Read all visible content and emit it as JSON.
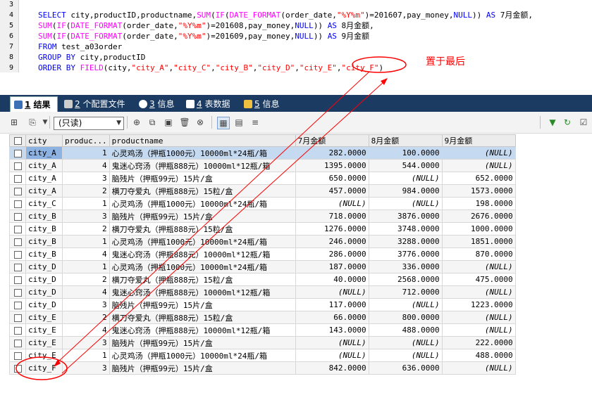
{
  "editor": {
    "lines": [
      {
        "n": "3",
        "parts": []
      },
      {
        "n": "4",
        "parts": [
          {
            "c": "k",
            "t": "SELECT"
          },
          {
            "c": "t",
            "t": " city,productID,productname,"
          },
          {
            "c": "f",
            "t": "SUM"
          },
          {
            "c": "t",
            "t": "("
          },
          {
            "c": "f",
            "t": "IF"
          },
          {
            "c": "t",
            "t": "("
          },
          {
            "c": "f",
            "t": "DATE_FORMAT"
          },
          {
            "c": "t",
            "t": "(order_date,"
          },
          {
            "c": "s",
            "t": "\"%Y%m\""
          },
          {
            "c": "t",
            "t": ")=201607,pay_money,"
          },
          {
            "c": "k",
            "t": "NULL"
          },
          {
            "c": "t",
            "t": ")) "
          },
          {
            "c": "k",
            "t": "AS"
          },
          {
            "c": "t",
            "t": " 7月金额,"
          }
        ]
      },
      {
        "n": "5",
        "parts": [
          {
            "c": "f",
            "t": "SUM"
          },
          {
            "c": "t",
            "t": "("
          },
          {
            "c": "f",
            "t": "IF"
          },
          {
            "c": "t",
            "t": "("
          },
          {
            "c": "f",
            "t": "DATE_FORMAT"
          },
          {
            "c": "t",
            "t": "(order_date,"
          },
          {
            "c": "s",
            "t": "\"%Y%m\""
          },
          {
            "c": "t",
            "t": ")=201608,pay_money,"
          },
          {
            "c": "k",
            "t": "NULL"
          },
          {
            "c": "t",
            "t": ")) "
          },
          {
            "c": "k",
            "t": "AS"
          },
          {
            "c": "t",
            "t": " 8月金额,"
          }
        ]
      },
      {
        "n": "6",
        "parts": [
          {
            "c": "f",
            "t": "SUM"
          },
          {
            "c": "t",
            "t": "("
          },
          {
            "c": "f",
            "t": "IF"
          },
          {
            "c": "t",
            "t": "("
          },
          {
            "c": "f",
            "t": "DATE_FORMAT"
          },
          {
            "c": "t",
            "t": "(order_date,"
          },
          {
            "c": "s",
            "t": "\"%Y%m\""
          },
          {
            "c": "t",
            "t": ")=201609,pay_money,"
          },
          {
            "c": "k",
            "t": "NULL"
          },
          {
            "c": "t",
            "t": ")) "
          },
          {
            "c": "k",
            "t": "AS"
          },
          {
            "c": "t",
            "t": " 9月金额"
          }
        ]
      },
      {
        "n": "7",
        "parts": [
          {
            "c": "k",
            "t": "FROM"
          },
          {
            "c": "t",
            "t": " test_a03order"
          }
        ]
      },
      {
        "n": "8",
        "parts": [
          {
            "c": "k",
            "t": "GROUP BY"
          },
          {
            "c": "t",
            "t": " city,productID"
          }
        ]
      },
      {
        "n": "9",
        "parts": [
          {
            "c": "k",
            "t": "ORDER BY"
          },
          {
            "c": "t",
            "t": " "
          },
          {
            "c": "f",
            "t": "FIELD"
          },
          {
            "c": "t",
            "t": "(city,"
          },
          {
            "c": "s",
            "t": "\"city_A\""
          },
          {
            "c": "t",
            "t": ","
          },
          {
            "c": "s",
            "t": "\"city_C\""
          },
          {
            "c": "t",
            "t": ","
          },
          {
            "c": "s",
            "t": "\"city_B\""
          },
          {
            "c": "t",
            "t": ","
          },
          {
            "c": "s",
            "t": "\"city_D\""
          },
          {
            "c": "t",
            "t": ","
          },
          {
            "c": "s",
            "t": "\"city_E\""
          },
          {
            "c": "t",
            "t": ","
          },
          {
            "c": "s",
            "t": "\"city_F\""
          },
          {
            "c": "t",
            "t": ")"
          }
        ]
      }
    ]
  },
  "annotation": {
    "note": "置于最后",
    "color": "#ff0000"
  },
  "tabs": [
    {
      "num": "1",
      "label": " 结果",
      "icon": "result-grid-icon",
      "active": true
    },
    {
      "num": "2",
      "label": " 个配置文件",
      "icon": "profile-icon",
      "active": false
    },
    {
      "num": "3",
      "label": " 信息",
      "icon": "info-icon",
      "active": false
    },
    {
      "num": "4",
      "label": " 表数据",
      "icon": "table-data-icon",
      "active": false
    },
    {
      "num": "5",
      "label": " 信息",
      "icon": "info-extra-icon",
      "active": false
    }
  ],
  "toolbar": {
    "mode_select": "(只读)"
  },
  "grid": {
    "columns": [
      "city",
      "produc...",
      "productname",
      "7月金额",
      "8月金额",
      "9月金额"
    ],
    "rows": [
      [
        "city_A",
        "1",
        "心灵鸡汤（押瓶1000元）10000ml*24瓶/箱",
        "282.0000",
        "100.0000",
        "(NULL)"
      ],
      [
        "city_A",
        "4",
        "鬼迷心窍汤（押瓶888元）10000ml*12瓶/箱",
        "1395.0000",
        "544.0000",
        "(NULL)"
      ],
      [
        "city_A",
        "3",
        "脑残片（押瓶99元）15片/盒",
        "650.0000",
        "(NULL)",
        "652.0000"
      ],
      [
        "city_A",
        "2",
        "横刀夺爱丸（押瓶888元）15粒/盒",
        "457.0000",
        "984.0000",
        "1573.0000"
      ],
      [
        "city_C",
        "1",
        "心灵鸡汤（押瓶1000元）10000ml*24瓶/箱",
        "(NULL)",
        "(NULL)",
        "198.0000"
      ],
      [
        "city_B",
        "3",
        "脑残片（押瓶99元）15片/盒",
        "718.0000",
        "3876.0000",
        "2676.0000"
      ],
      [
        "city_B",
        "2",
        "横刀夺爱丸（押瓶888元）15粒/盒",
        "1276.0000",
        "3748.0000",
        "1000.0000"
      ],
      [
        "city_B",
        "1",
        "心灵鸡汤（押瓶1000元）10000ml*24瓶/箱",
        "246.0000",
        "3288.0000",
        "1851.0000"
      ],
      [
        "city_B",
        "4",
        "鬼迷心窍汤（押瓶888元）10000ml*12瓶/箱",
        "286.0000",
        "3776.0000",
        "870.0000"
      ],
      [
        "city_D",
        "1",
        "心灵鸡汤（押瓶1000元）10000ml*24瓶/箱",
        "187.0000",
        "336.0000",
        "(NULL)"
      ],
      [
        "city_D",
        "2",
        "横刀夺爱丸（押瓶888元）15粒/盒",
        "40.0000",
        "2568.0000",
        "475.0000"
      ],
      [
        "city_D",
        "4",
        "鬼迷心窍汤（押瓶888元）10000ml*12瓶/箱",
        "(NULL)",
        "712.0000",
        "(NULL)"
      ],
      [
        "city_D",
        "3",
        "脑残片（押瓶99元）15片/盒",
        "117.0000",
        "(NULL)",
        "1223.0000"
      ],
      [
        "city_E",
        "2",
        "横刀夺爱丸（押瓶888元）15粒/盒",
        "66.0000",
        "800.0000",
        "(NULL)"
      ],
      [
        "city_E",
        "4",
        "鬼迷心窍汤（押瓶888元）10000ml*12瓶/箱",
        "143.0000",
        "488.0000",
        "(NULL)"
      ],
      [
        "city_E",
        "3",
        "脑残片（押瓶99元）15片/盒",
        "(NULL)",
        "(NULL)",
        "222.0000"
      ],
      [
        "city_E",
        "1",
        "心灵鸡汤（押瓶1000元）10000ml*24瓶/箱",
        "(NULL)",
        "(NULL)",
        "488.0000"
      ],
      [
        "city_F",
        "3",
        "脑残片（押瓶99元）15片/盒",
        "842.0000",
        "636.0000",
        "(NULL)"
      ]
    ]
  }
}
